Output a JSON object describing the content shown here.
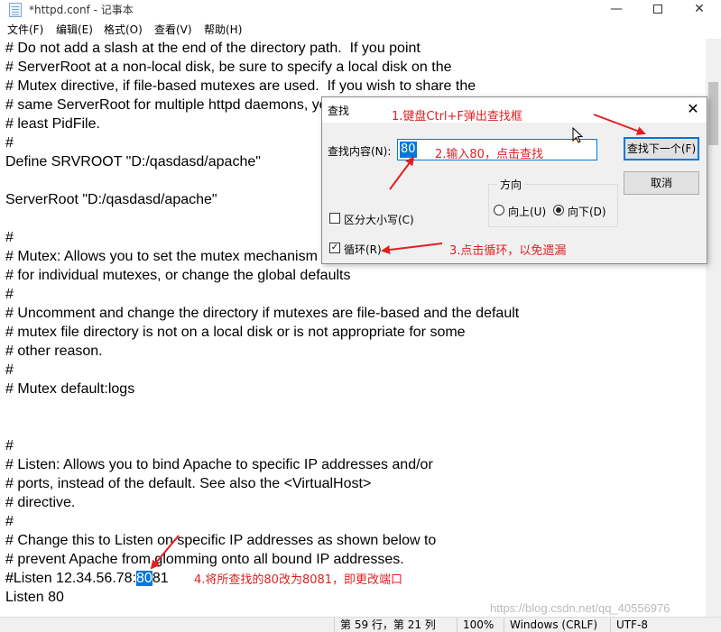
{
  "window": {
    "title": "*httpd.conf - 记事本",
    "minimize": "—",
    "close": "✕"
  },
  "menu": [
    "文件(F)",
    "编辑(E)",
    "格式(O)",
    "查看(V)",
    "帮助(H)"
  ],
  "editor": {
    "lines": [
      "# Do not add a slash at the end of the directory path.  If you point",
      "# ServerRoot at a non-local disk, be sure to specify a local disk on the",
      "# Mutex directive, if file-based mutexes are used.  If you wish to share the",
      "# same ServerRoot for multiple httpd daemons, you will need to change at",
      "# least PidFile.",
      "#",
      "Define SRVROOT \"D:/qasdasd/apache\"",
      "",
      "ServerRoot \"D:/qasdasd/apache\"",
      "",
      "#",
      "# Mutex: Allows you to set the mutex mechanism and mutex file directory",
      "# for individual mutexes, or change the global defaults",
      "#",
      "# Uncomment and change the directory if mutexes are file-based and the default",
      "# mutex file directory is not on a local disk or is not appropriate for some",
      "# other reason.",
      "#",
      "# Mutex default:logs",
      "",
      "",
      "#",
      "# Listen: Allows you to bind Apache to specific IP addresses and/or",
      "# ports, instead of the default. See also the <VirtualHost>",
      "# directive.",
      "#",
      "# Change this to Listen on specific IP addresses as shown below to",
      "# prevent Apache from glomming onto all bound IP addresses.",
      "#"
    ],
    "listen_line": {
      "before": "#Listen 12.34.56.78:",
      "highlight": "80",
      "after": "81"
    },
    "last_line": "Listen 80"
  },
  "status": {
    "position": "第 59 行，第 21 列",
    "zoom": "100%",
    "eol": "Windows (CRLF)",
    "encoding": "UTF-8"
  },
  "watermark": "https://blog.csdn.net/qq_40556976",
  "dialog": {
    "title": "查找",
    "find_label": "查找内容(N):",
    "find_value": "80",
    "find_next": "查找下一个(F)",
    "cancel": "取消",
    "direction_label": "方向",
    "up": "向上(U)",
    "down": "向下(D)",
    "match_case": "区分大小写(C)",
    "wrap": "循环(R)",
    "close": "✕"
  },
  "annotations": {
    "a1": "1.键盘Ctrl+F弹出查找框",
    "a2": "2.输入80，点击查找",
    "a3": "3.点击循环，以免遗漏",
    "a4": "4.将所查找的80改为8081，即更改端口"
  },
  "colors": {
    "highlight": "#0078d7",
    "annotation": "#e02020"
  }
}
